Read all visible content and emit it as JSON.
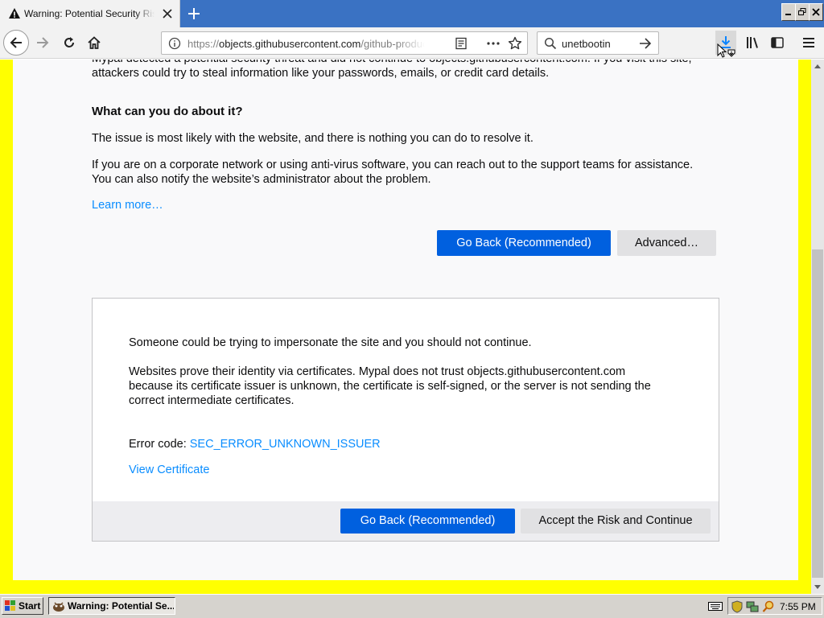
{
  "browser": {
    "tab": {
      "title": "Warning: Potential Security Risk Ahead",
      "icon": "warning-icon"
    },
    "url": {
      "prefix": "https://",
      "host": "objects.githubusercontent.com",
      "path": "/github-production-release-asset"
    },
    "search": {
      "value": "unetbootin"
    }
  },
  "page": {
    "intro_line1": "Mypal detected a potential security threat and did not continue to objects.githubusercontent.com. If you visit this site,",
    "intro_line2": "attackers could try to steal information like your passwords, emails, or credit card details.",
    "what_heading": "What can you do about it?",
    "issue_text": "The issue is most likely with the website, and there is nothing you can do to resolve it.",
    "corp_line1": "If you are on a corporate network or using anti-virus software, you can reach out to the support teams for assistance.",
    "corp_line2": "You can also notify the website’s administrator about the problem.",
    "learn_more": "Learn more…",
    "go_back": "Go Back (Recommended)",
    "advanced": "Advanced…"
  },
  "advanced_panel": {
    "impersonate": "Someone could be trying to impersonate the site and you should not continue.",
    "cert_line1": "Websites prove their identity via certificates. Mypal does not trust objects.githubusercontent.com",
    "cert_line2": "because its certificate issuer is unknown, the certificate is self-signed, or the server is not sending the",
    "cert_line3": "correct intermediate certificates.",
    "error_label": "Error code: ",
    "error_code": "SEC_ERROR_UNKNOWN_ISSUER",
    "view_certificate": "View Certificate",
    "go_back": "Go Back (Recommended)",
    "accept": "Accept the Risk and Continue"
  },
  "taskbar": {
    "start": "Start",
    "task": "Warning: Potential Se...",
    "clock": "7:55 PM"
  },
  "colors": {
    "accent": "#0060df",
    "link": "#0a8dff",
    "border_highlight": "#ffff00",
    "tabstrip": "#3a72c3"
  }
}
